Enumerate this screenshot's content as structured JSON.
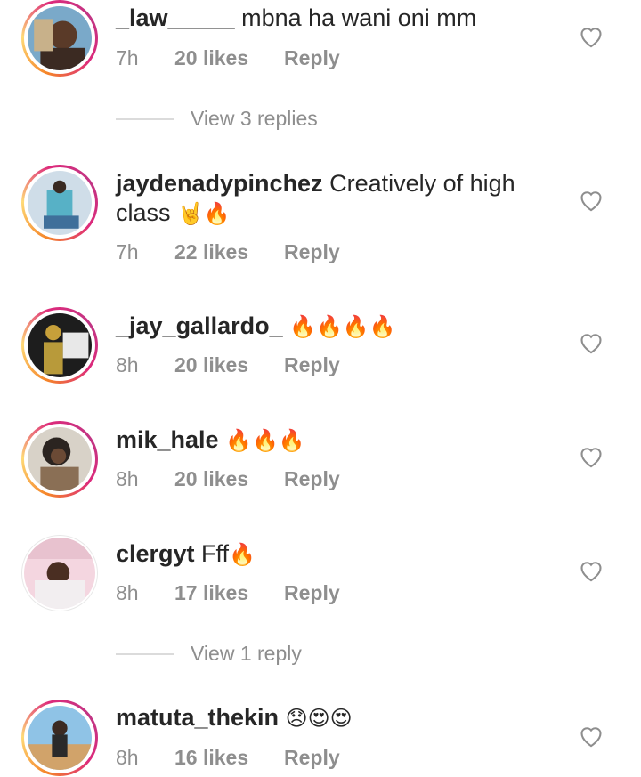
{
  "comments": [
    {
      "username": "_law_____",
      "text": " mbna ha wani oni mm",
      "emoji": "",
      "time": "7h",
      "likes": "20 likes",
      "reply": "Reply",
      "avatar_icon": "user-avatar"
    },
    {
      "username": "jaydenadypinchez",
      "text": " Creatively of high class ",
      "emoji": "🤘🔥",
      "time": "7h",
      "likes": "22 likes",
      "reply": "Reply",
      "avatar_icon": "user-avatar"
    },
    {
      "username": "_jay_gallardo_",
      "text": " ",
      "emoji": "🔥🔥🔥🔥",
      "time": "8h",
      "likes": "20 likes",
      "reply": "Reply",
      "avatar_icon": "user-avatar"
    },
    {
      "username": "mik_hale",
      "text": " ",
      "emoji": "🔥🔥🔥",
      "time": "8h",
      "likes": "20 likes",
      "reply": "Reply",
      "avatar_icon": "user-avatar"
    },
    {
      "username": "clergyt",
      "text": " Fff",
      "emoji": "🔥",
      "time": "8h",
      "likes": "17 likes",
      "reply": "Reply",
      "avatar_icon": "user-avatar"
    },
    {
      "username": "matuta_thekin",
      "text": " ",
      "emoji": "😞😍😍",
      "time": "8h",
      "likes": "16 likes",
      "reply": "Reply",
      "avatar_icon": "user-avatar"
    }
  ],
  "view_replies": [
    {
      "label": "View 3 replies"
    },
    {
      "label": "View 1 reply"
    }
  ],
  "colors": {
    "text": "#262626",
    "secondary": "#8e8e8e",
    "divider": "#dbdbdb",
    "story_ring_start": "#f58529",
    "story_ring_end": "#dd2a7b"
  },
  "icons": {
    "like": "heart-outline-icon"
  }
}
